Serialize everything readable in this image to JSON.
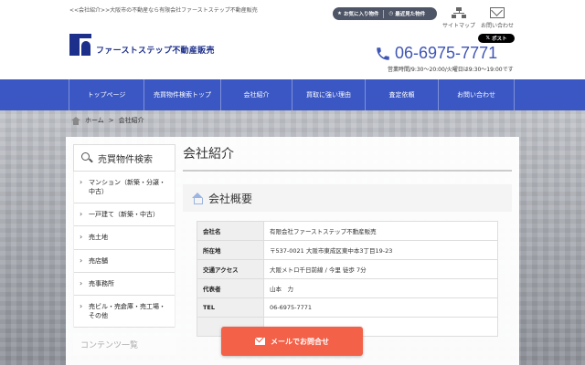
{
  "header": {
    "tagline": "<<会社紹介>>大阪市の不動産なら有限会社ファーストステップ不動産販売",
    "logo_text": "ファーストステップ不動産販売",
    "favorites_label": "お気に入り物件",
    "recent_label": "最近見た物件",
    "sitemap_label": "サイトマップ",
    "contact_label": "お問い合わせ",
    "xpost_label": "ポスト",
    "phone": "06-6975-7771",
    "hours": "営業時間/9:30～20:00/火曜日は9:30～19:00です",
    "accent_color": "#3a57c4"
  },
  "nav": {
    "items": [
      {
        "label": "トップページ"
      },
      {
        "label": "売買物件検索トップ"
      },
      {
        "label": "会社紹介"
      },
      {
        "label": "買取に強い理由"
      },
      {
        "label": "査定依頼"
      },
      {
        "label": "お問い合わせ"
      }
    ]
  },
  "breadcrumb": {
    "home": "ホーム",
    "separator": ">",
    "current": "会社紹介"
  },
  "sidebar": {
    "title": "売買物件検索",
    "items": [
      {
        "label": "マンション（新築・分譲・中古）"
      },
      {
        "label": "一戸建て（新築・中古）"
      },
      {
        "label": "売土地"
      },
      {
        "label": "売店舗"
      },
      {
        "label": "売事務所"
      },
      {
        "label": "売ビル・売倉庫・売工場・その他"
      }
    ],
    "faded_title": "コンテンツ一覧"
  },
  "main": {
    "title": "会社紹介",
    "section_title": "会社概要",
    "rows": [
      {
        "key": "会社名",
        "value": "有限会社ファーストステップ不動産販売"
      },
      {
        "key": "所在地",
        "value": "〒537-0021 大阪市東成区東中本3丁目19-23"
      },
      {
        "key": "交通アクセス",
        "value": "大阪メトロ千日前線 / 今里 徒歩 7分"
      },
      {
        "key": "代表者",
        "value": "山本　力"
      },
      {
        "key": "TEL",
        "value": "06-6975-7771"
      }
    ]
  },
  "cta": {
    "label": "メールでお問合せ",
    "color": "#f26148"
  }
}
